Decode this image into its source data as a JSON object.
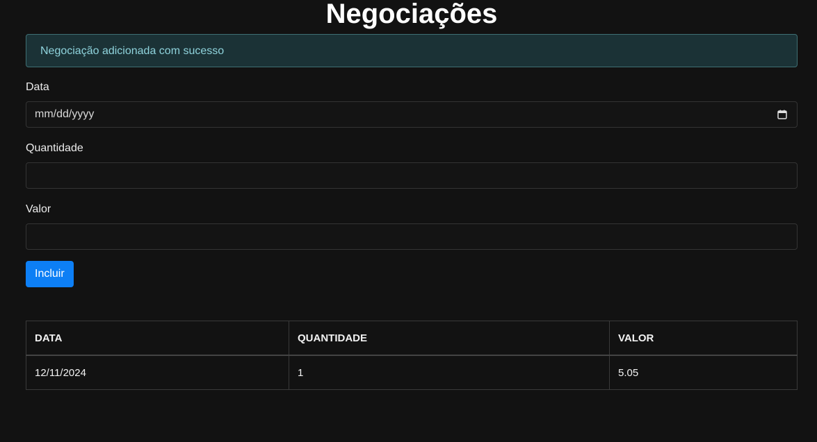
{
  "header": {
    "title": "Negociações"
  },
  "alert": {
    "message": "Negociação adicionada com sucesso"
  },
  "form": {
    "date": {
      "label": "Data",
      "placeholder": "mm/dd/yyyy",
      "icon": "calendar-icon"
    },
    "quantity": {
      "label": "Quantidade",
      "value": ""
    },
    "value": {
      "label": "Valor",
      "value": ""
    },
    "submit_label": "Incluir"
  },
  "table": {
    "headers": [
      "DATA",
      "QUANTIDADE",
      "VALOR"
    ],
    "rows": [
      [
        "12/11/2024",
        "1",
        "5.05"
      ]
    ]
  },
  "colors": {
    "background": "#121212",
    "alert_background": "#1b3236",
    "alert_text": "#8fd3dc",
    "primary_button": "#0d7ff5"
  }
}
